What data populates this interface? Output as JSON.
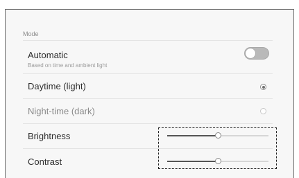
{
  "section": {
    "label": "Mode"
  },
  "automatic": {
    "label": "Automatic",
    "description": "Based on time and ambient light",
    "enabled": false
  },
  "options": [
    {
      "label": "Daytime (light)",
      "selected": true
    },
    {
      "label": "Night-time (dark)",
      "selected": false
    }
  ],
  "sliders": [
    {
      "label": "Brightness",
      "value": 0.5
    },
    {
      "label": "Contrast",
      "value": 0.5
    }
  ]
}
